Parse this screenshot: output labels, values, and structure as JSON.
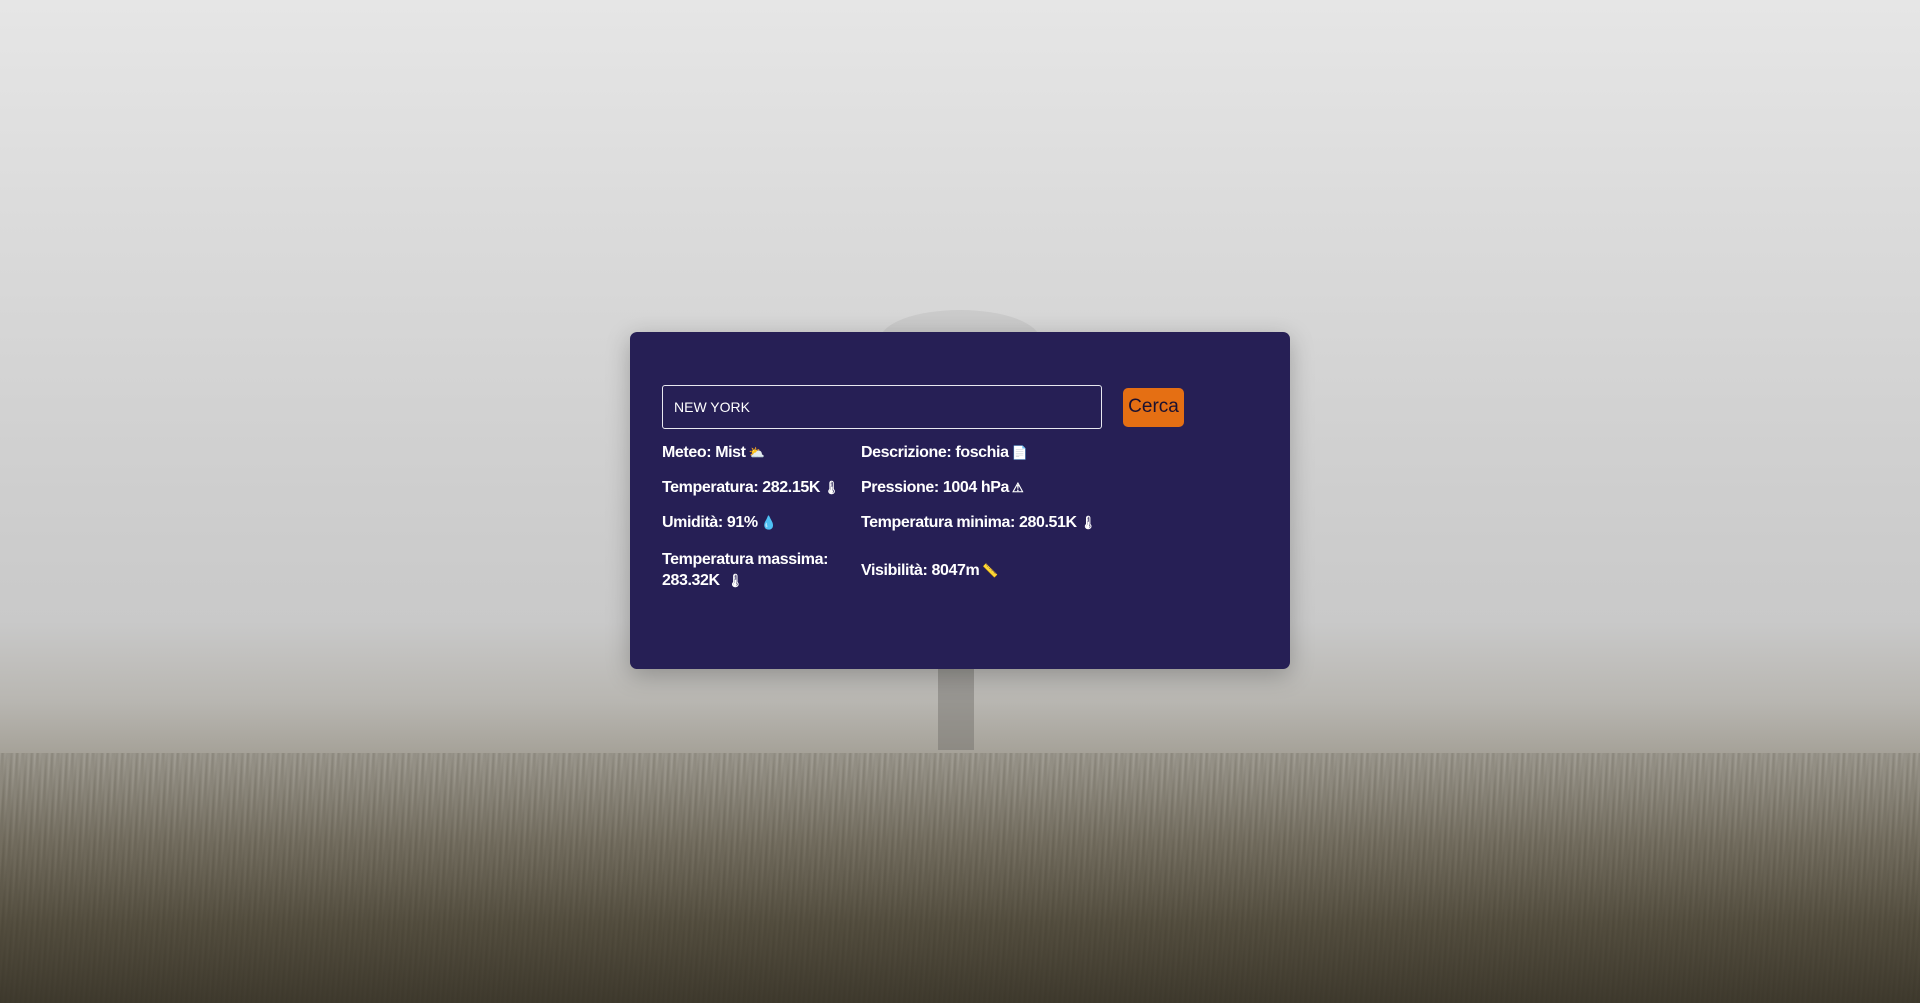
{
  "search": {
    "value": "NEW YORK",
    "button_label": "Cerca"
  },
  "weather": {
    "meteo": "Meteo: Mist",
    "descrizione": "Descrizione: foschia",
    "temperatura": "Temperatura: 282.15K",
    "pressione": "Pressione: 1004 hPa",
    "umidita": "Umidità: 91%",
    "temp_min": "Temperatura minima: 280.51K",
    "temp_max": "Temperatura massima: 283.32K",
    "visibilita": "Visibilità: 8047m"
  },
  "icons": {
    "meteo": "⛅",
    "descrizione": "📄",
    "temperatura": "🌡",
    "pressione": "⚠",
    "umidita": "💧",
    "temp_min": "🌡",
    "temp_max": "🌡",
    "visibilita": "📏"
  },
  "colors": {
    "card": "#261f55",
    "button": "#e56f13"
  }
}
